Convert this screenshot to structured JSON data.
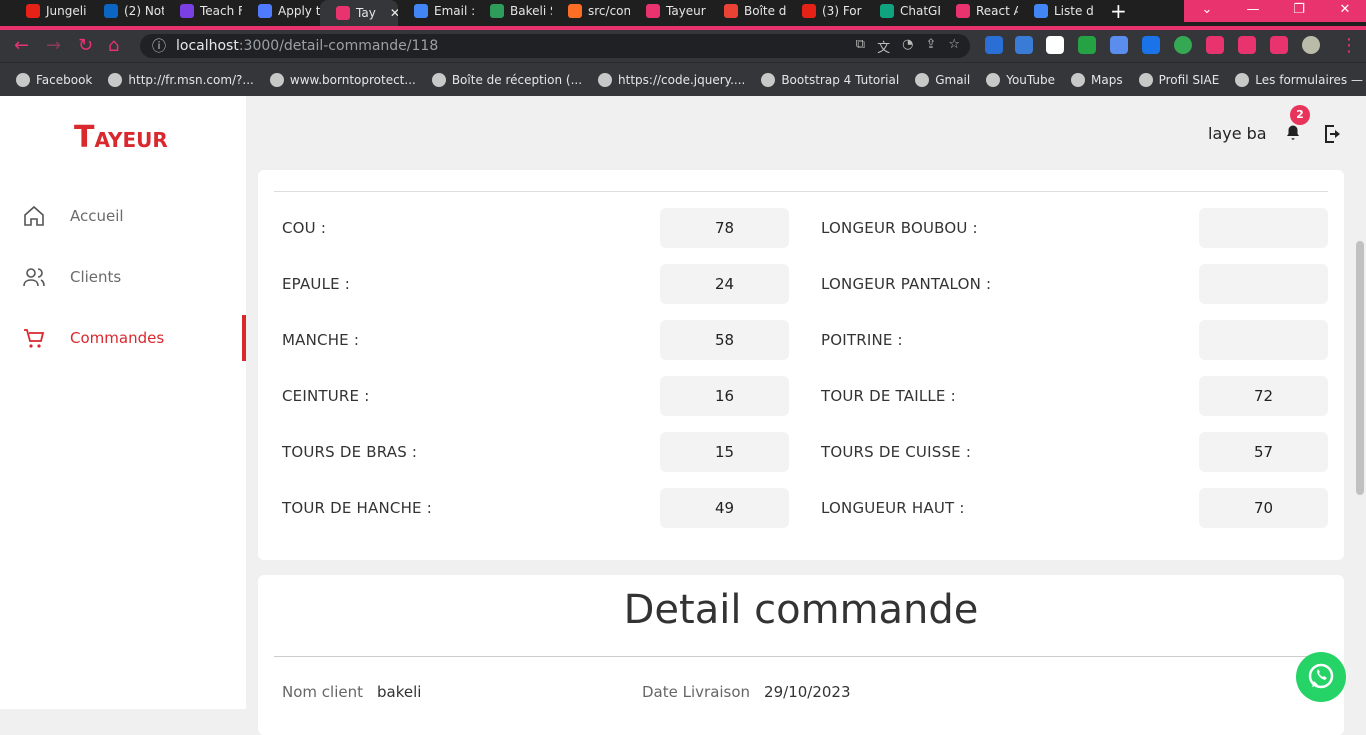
{
  "browser": {
    "tabs": [
      {
        "label": "Jungeli",
        "color": "#e62117"
      },
      {
        "label": "(2) Not",
        "color": "#0a66c2"
      },
      {
        "label": "Teach F",
        "color": "#7b3fe4"
      },
      {
        "label": "Apply t",
        "color": "#4f7cff"
      },
      {
        "label": "Tay",
        "color": "#e8336f",
        "active": true
      },
      {
        "label": "Email :",
        "color": "#4285f4"
      },
      {
        "label": "Bakeli S",
        "color": "#2e9c5a"
      },
      {
        "label": "src/con",
        "color": "#fc6d26"
      },
      {
        "label": "Tayeur",
        "color": "#e8336f"
      },
      {
        "label": "Boîte d",
        "color": "#ea4335"
      },
      {
        "label": "(3) For",
        "color": "#e62117"
      },
      {
        "label": "ChatGP",
        "color": "#10a37f"
      },
      {
        "label": "React A",
        "color": "#e8336f"
      },
      {
        "label": "Liste d",
        "color": "#4285f4"
      }
    ],
    "url_host": "localhost",
    "url_path": ":3000/detail-commande/118",
    "bookmarks": [
      {
        "label": "Facebook"
      },
      {
        "label": "http://fr.msn.com/?..."
      },
      {
        "label": "www.borntoprotect..."
      },
      {
        "label": "Boîte de réception (..."
      },
      {
        "label": "https://code.jquery...."
      },
      {
        "label": "Bootstrap 4 Tutorial"
      },
      {
        "label": "Gmail"
      },
      {
        "label": "YouTube"
      },
      {
        "label": "Maps"
      },
      {
        "label": "Profil SIAE"
      },
      {
        "label": "Les formulaires — F..."
      }
    ]
  },
  "app": {
    "logo": "AYEUR",
    "logo_initial": "T",
    "accent": "#d9282e",
    "nav": [
      {
        "label": "Accueil",
        "icon": "home-icon"
      },
      {
        "label": "Clients",
        "icon": "users-icon"
      },
      {
        "label": "Commandes",
        "icon": "cart-icon",
        "active": true
      }
    ],
    "user_name": "laye ba",
    "notification_count": "2"
  },
  "measurements": {
    "left": [
      {
        "label": "COU :",
        "value": "78"
      },
      {
        "label": "EPAULE :",
        "value": "24"
      },
      {
        "label": "MANCHE :",
        "value": "58"
      },
      {
        "label": "CEINTURE :",
        "value": "16"
      },
      {
        "label": "TOURS DE BRAS :",
        "value": "15"
      },
      {
        "label": "TOUR DE HANCHE :",
        "value": "49"
      }
    ],
    "right": [
      {
        "label": "LONGEUR BOUBOU :",
        "value": ""
      },
      {
        "label": "LONGEUR PANTALON :",
        "value": ""
      },
      {
        "label": "POITRINE :",
        "value": ""
      },
      {
        "label": "TOUR DE TAILLE :",
        "value": "72"
      },
      {
        "label": "TOURS DE CUISSE :",
        "value": "57"
      },
      {
        "label": "LONGUEUR HAUT :",
        "value": "70"
      }
    ]
  },
  "detail": {
    "title": "Detail commande",
    "client_label": "Nom client",
    "client_value": "bakeli",
    "date_label": "Date Livraison",
    "date_value": "29/10/2023"
  }
}
